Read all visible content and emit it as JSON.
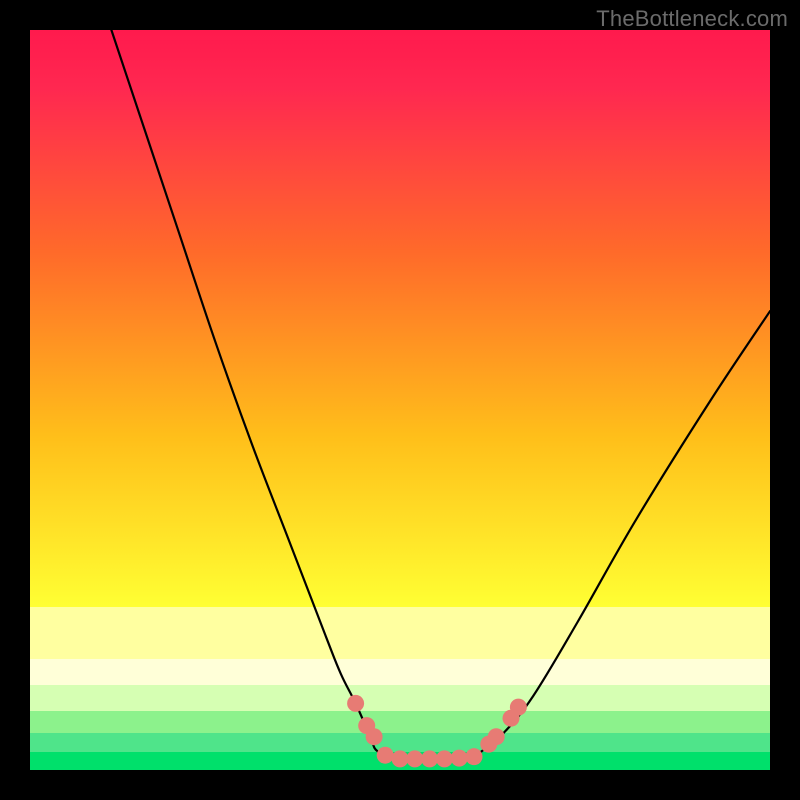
{
  "watermark": "TheBottleneck.com",
  "colors": {
    "black": "#000000",
    "magenta_top": "#ff1a4d",
    "orange_mid": "#ff9a2d",
    "yellow": "#ffff33",
    "pale_yellow": "#ffffa0",
    "green_light": "#7fff66",
    "green_strong": "#00e06b",
    "curve": "#000000",
    "marker_fill": "#e77b74",
    "marker_stroke": "#d45f57"
  },
  "chart_data": {
    "type": "line",
    "title": "",
    "xlabel": "",
    "ylabel": "",
    "xlim": [
      0,
      100
    ],
    "ylim": [
      0,
      100
    ],
    "series": [
      {
        "name": "left-branch",
        "x": [
          11,
          15,
          20,
          25,
          30,
          35,
          40,
          42,
          44,
          46,
          47
        ],
        "y": [
          100,
          88,
          73,
          58,
          44,
          31,
          18,
          13,
          9,
          4.5,
          2.5
        ]
      },
      {
        "name": "flat-bottom",
        "x": [
          47,
          50,
          55,
          60,
          61
        ],
        "y": [
          2.5,
          1.5,
          1.5,
          1.8,
          2.5
        ]
      },
      {
        "name": "right-branch",
        "x": [
          61,
          64,
          68,
          74,
          82,
          92,
          100
        ],
        "y": [
          2.5,
          5,
          10,
          20,
          34,
          50,
          62
        ]
      }
    ],
    "markers": [
      {
        "x": 44.0,
        "y": 9.0
      },
      {
        "x": 45.5,
        "y": 6.0
      },
      {
        "x": 46.5,
        "y": 4.5
      },
      {
        "x": 48.0,
        "y": 2.0
      },
      {
        "x": 50.0,
        "y": 1.5
      },
      {
        "x": 52.0,
        "y": 1.5
      },
      {
        "x": 54.0,
        "y": 1.5
      },
      {
        "x": 56.0,
        "y": 1.5
      },
      {
        "x": 58.0,
        "y": 1.6
      },
      {
        "x": 60.0,
        "y": 1.8
      },
      {
        "x": 62.0,
        "y": 3.5
      },
      {
        "x": 63.0,
        "y": 4.5
      },
      {
        "x": 65.0,
        "y": 7.0
      },
      {
        "x": 66.0,
        "y": 8.5
      }
    ],
    "gradient_stops": [
      {
        "pos": 0.0,
        "color": "#ff1a4d"
      },
      {
        "pos": 0.08,
        "color": "#ff2850"
      },
      {
        "pos": 0.3,
        "color": "#ff6a2a"
      },
      {
        "pos": 0.55,
        "color": "#ffbf1a"
      },
      {
        "pos": 0.78,
        "color": "#ffff33"
      }
    ],
    "bottom_bands": [
      {
        "from": 0.78,
        "to": 0.85,
        "color": "#ffffa0"
      },
      {
        "from": 0.85,
        "to": 0.885,
        "color": "#ffffd8"
      },
      {
        "from": 0.885,
        "to": 0.92,
        "color": "#d6ffb3"
      },
      {
        "from": 0.92,
        "to": 0.95,
        "color": "#8cf28c"
      },
      {
        "from": 0.95,
        "to": 0.975,
        "color": "#4fe48a"
      },
      {
        "from": 0.975,
        "to": 1.0,
        "color": "#00e06b"
      }
    ]
  }
}
